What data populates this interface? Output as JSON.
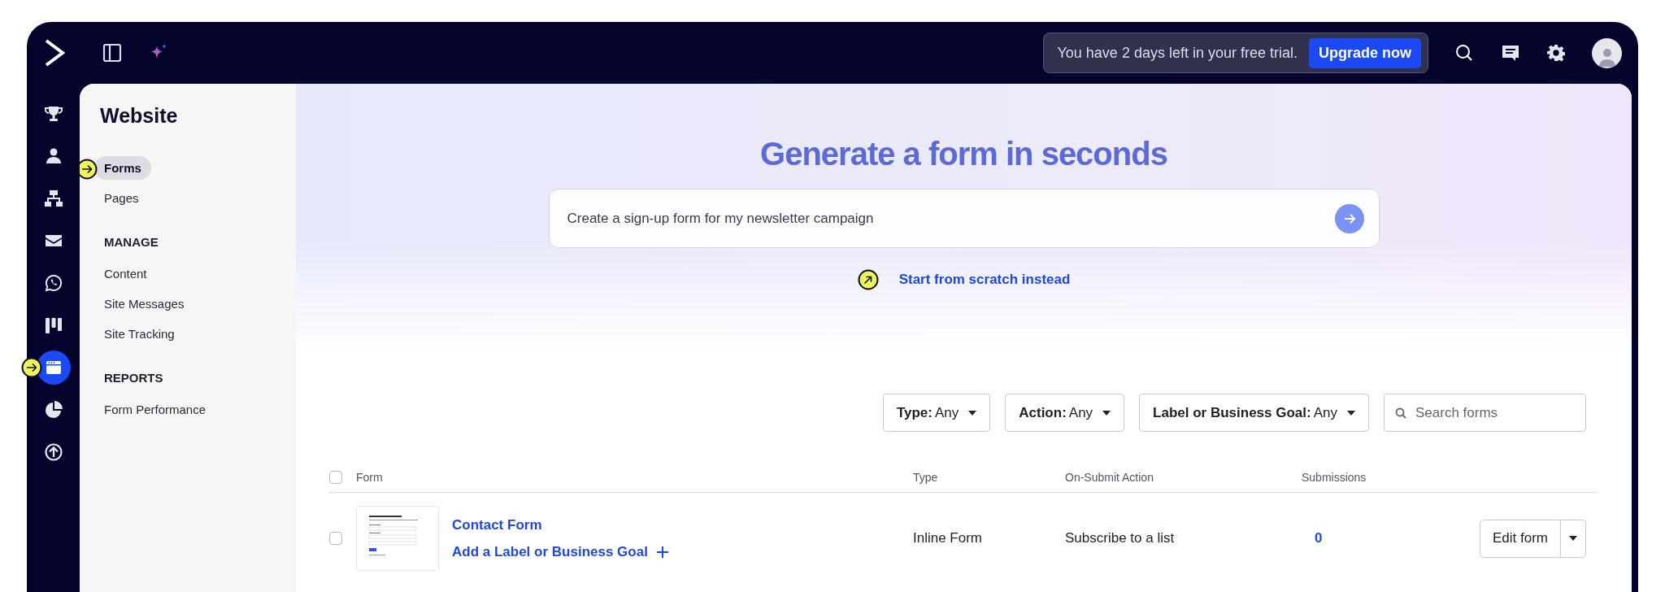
{
  "topbar": {
    "trial_message": "You have 2 days left in your free trial.",
    "upgrade_button": "Upgrade now"
  },
  "rail": [
    {
      "selected": false,
      "marker": false
    },
    {
      "selected": false,
      "marker": false
    },
    {
      "selected": false,
      "marker": false
    },
    {
      "selected": false,
      "marker": false
    },
    {
      "selected": false,
      "marker": false
    },
    {
      "selected": false,
      "marker": false
    },
    {
      "selected": true,
      "marker": true
    },
    {
      "selected": false,
      "marker": false
    },
    {
      "selected": false,
      "marker": false
    }
  ],
  "sidebar": {
    "title": "Website",
    "sections": [
      {
        "items": [
          {
            "label": "Forms",
            "selected": true,
            "marker": true
          },
          {
            "label": "Pages",
            "selected": false,
            "marker": false
          }
        ]
      },
      {
        "heading": "MANAGE",
        "items": [
          {
            "label": "Content",
            "selected": false,
            "marker": false
          },
          {
            "label": "Site Messages",
            "selected": false,
            "marker": false
          },
          {
            "label": "Site Tracking",
            "selected": false,
            "marker": false
          }
        ]
      },
      {
        "heading": "REPORTS",
        "items": [
          {
            "label": "Form Performance",
            "selected": false,
            "marker": false
          }
        ]
      }
    ]
  },
  "hero": {
    "title": "Generate a form in seconds",
    "prompt": {
      "value": "Create a sign-up form for my newsletter campaign"
    },
    "link": "Start from scratch instead",
    "link_marker": true
  },
  "filters": [
    {
      "label": "Type:",
      "value": "Any"
    },
    {
      "label": "Action:",
      "value": "Any"
    },
    {
      "label": "Label or Business Goal:",
      "value": "Any"
    }
  ],
  "search": {
    "placeholder": "Search forms"
  },
  "table": {
    "columns": [
      "Form",
      "Type",
      "On-Submit Action",
      "Submissions"
    ],
    "all_checked": false,
    "rows": [
      {
        "checked": false,
        "name": "Contact Form",
        "label_link": "Add a Label or Business Goal",
        "type": "Inline Form",
        "action": "Subscribe to a list",
        "submissions": "0",
        "button": "Edit form"
      }
    ]
  }
}
